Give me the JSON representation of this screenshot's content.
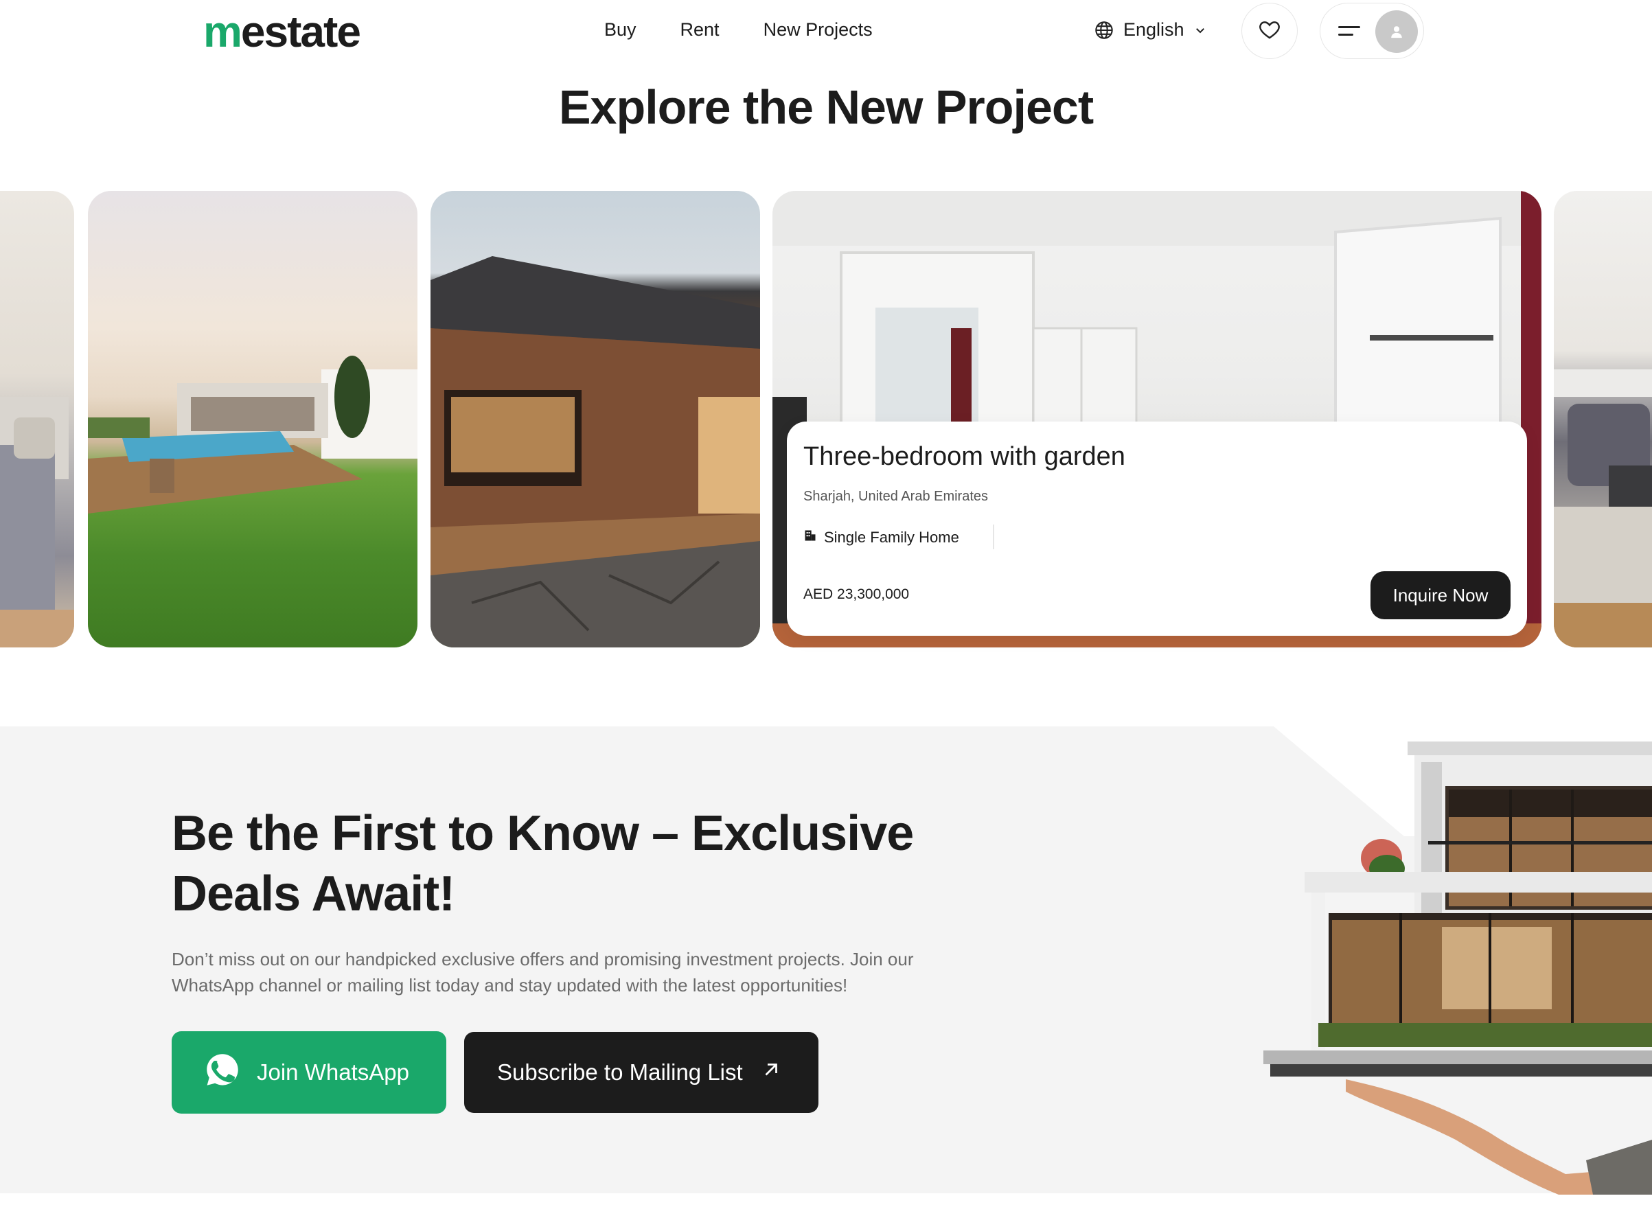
{
  "header": {
    "logo": {
      "first": "m",
      "rest": "estate"
    },
    "nav": [
      "Buy",
      "Rent",
      "New Projects"
    ],
    "language": "English"
  },
  "section": {
    "title": "Explore the New Project"
  },
  "featured": {
    "title": "Three-bedroom with garden",
    "location": "Sharjah, United Arab Emirates",
    "type": "Single Family Home",
    "price": "AED 23,300,000",
    "cta": "Inquire Now"
  },
  "cta": {
    "title": "Be the First to Know – Exclusive Deals Await!",
    "description": "Don’t miss out on our handpicked exclusive offers and promising investment projects. Join our WhatsApp channel or mailing list today and stay updated with the latest opportunities!",
    "whatsapp_label": "Join WhatsApp",
    "mailing_label": "Subscribe to Mailing List"
  },
  "colors": {
    "brand_green": "#1aa86a",
    "dark": "#1c1c1c",
    "section_bg": "#f4f4f4"
  }
}
